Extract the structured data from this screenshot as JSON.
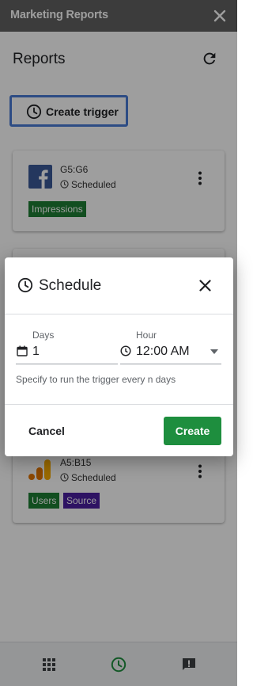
{
  "app": {
    "title": "Marketing Reports"
  },
  "page": {
    "title": "Reports"
  },
  "toolbar": {
    "create_trigger_label": "Create trigger"
  },
  "cards": [
    {
      "range": "G5:G6",
      "status": "Scheduled",
      "source_icon": "facebook-logo-icon",
      "badges": [
        "Impressions"
      ]
    },
    {
      "range": "A5:B15",
      "status": "Scheduled",
      "source_icon": "google-analytics-logo-icon",
      "badges": [
        "Users",
        "Source"
      ]
    }
  ],
  "dialog": {
    "title": "Schedule",
    "days_label": "Days",
    "days_value": "1",
    "hour_label": "Hour",
    "hour_value": "12:00 AM",
    "help_text": "Specify to run the trigger every n days",
    "cancel_label": "Cancel",
    "create_label": "Create"
  },
  "bottom_nav": [
    {
      "icon": "apps-grid-icon"
    },
    {
      "icon": "clock-icon",
      "active": true
    },
    {
      "icon": "feedback-icon"
    }
  ],
  "colors": {
    "topbar": "#616161",
    "primary_green": "#1e8e3e",
    "badge_impressions": "#1e7e34",
    "badge_users": "#1e7e34",
    "badge_source": "#4b1fa0",
    "focus_blue": "#4a7bd6",
    "facebook_blue": "#3b5998"
  }
}
